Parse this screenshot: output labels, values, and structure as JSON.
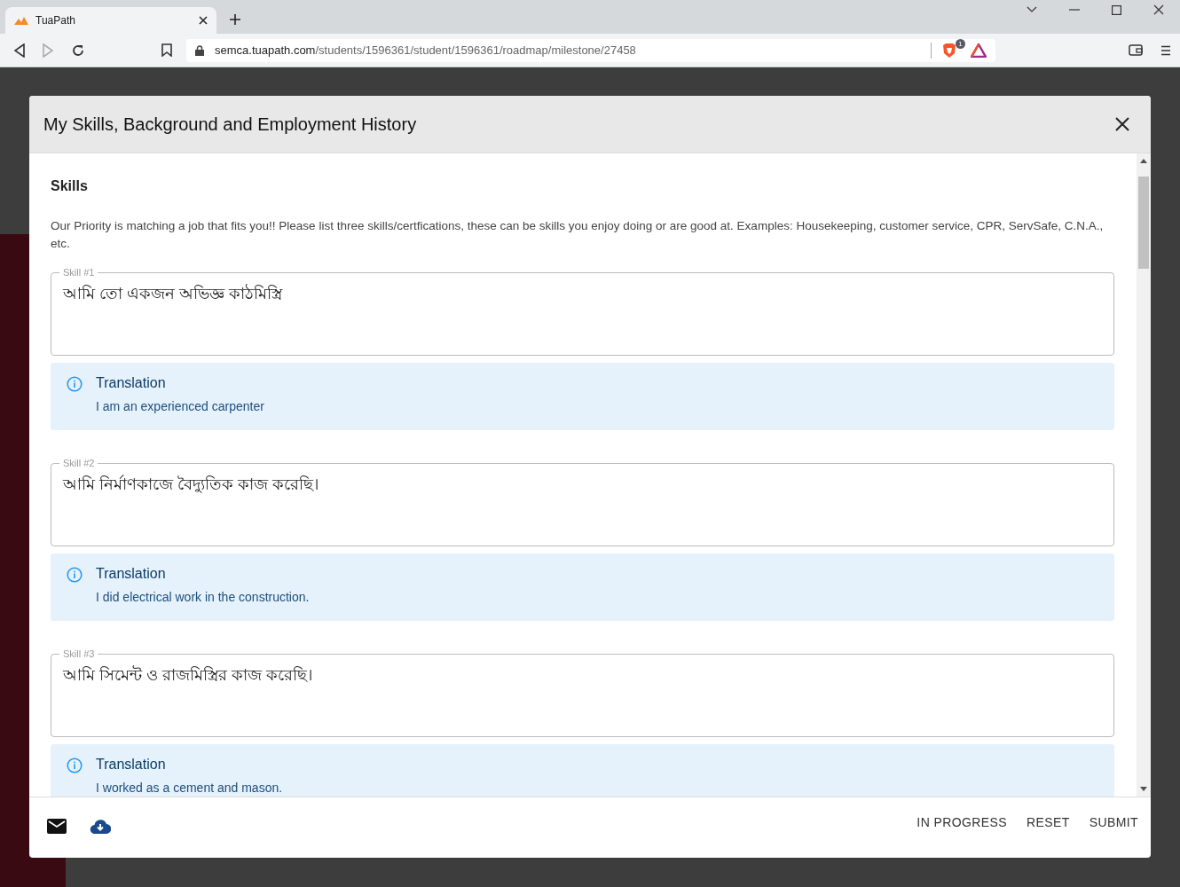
{
  "browser": {
    "tab": {
      "title": "TuaPath",
      "selected": true
    },
    "url_host": "semca.tuapath.com",
    "url_path": "/students/1596361/student/1596361/roadmap/milestone/27458",
    "shield_badge": "1"
  },
  "dialog": {
    "title": "My Skills, Background and Employment History",
    "section_title": "Skills",
    "intro": "Our Priority is matching a job that fits you!! Please list three skills/certfications, these can be skills you enjoy doing or are good at. Examples: Housekeeping, customer service, CPR, ServSafe, C.N.A., etc.",
    "skills": [
      {
        "label": "Skill #1",
        "value": "আমি তো একজন অভিজ্ঞ কাঠমিস্ত্রি",
        "translation_title": "Translation",
        "translation": "I am an experienced carpenter"
      },
      {
        "label": "Skill #2",
        "value": "আমি নির্মাণকাজে বৈদ্যুতিক কাজ করেছি।",
        "translation_title": "Translation",
        "translation": "I did electrical work in the construction."
      },
      {
        "label": "Skill #3",
        "value": "আমি সিমেন্ট ও রাজমিস্ত্রির কাজ করেছি।",
        "translation_title": "Translation",
        "translation": "I worked as a cement and mason."
      }
    ],
    "actions": [
      "IN PROGRESS",
      "RESET",
      "SUBMIT"
    ]
  }
}
